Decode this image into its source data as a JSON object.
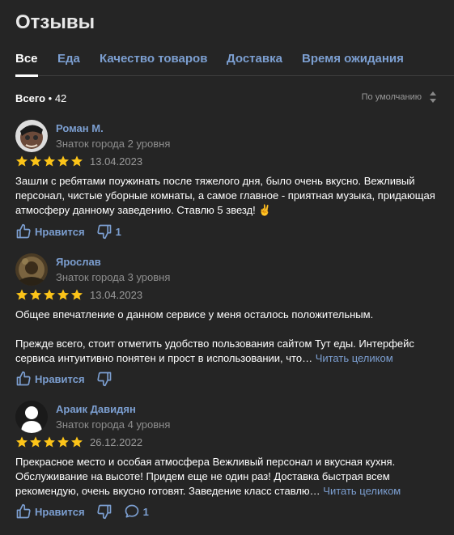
{
  "page": {
    "title": "Отзывы"
  },
  "tabs": [
    {
      "label": "Все",
      "active": true
    },
    {
      "label": "Еда"
    },
    {
      "label": "Качество товаров"
    },
    {
      "label": "Доставка"
    },
    {
      "label": "Время ожидания"
    }
  ],
  "summary": {
    "label": "Всего",
    "separator": " • ",
    "count": "42"
  },
  "sort": {
    "label": "По умолчанию"
  },
  "colors": {
    "accent": "#7c9fd1",
    "star": "#fcc419",
    "background": "#252525"
  },
  "reviews": [
    {
      "author": "Роман М.",
      "level": "Знаток города 2 уровня",
      "stars": 5,
      "date": "13.04.2023",
      "text": "Зашли с ребятами поужинать после тяжелого дня, было очень вкусно. Вежливый персонал, чистые уборные комнаты, а самое главное - приятная музыка, придающая атмосферу данному заведению. Ставлю 5 звезд! ✌",
      "more": "",
      "like_label": "Нравится",
      "dislike_count": "1",
      "comment_count": ""
    },
    {
      "author": "Ярослав",
      "level": "Знаток города 3 уровня",
      "stars": 5,
      "date": "13.04.2023",
      "text": "Общее впечатление о данном сервисе у меня осталось положительным.\n\nПрежде всего, стоит отметить удобство пользования сайтом Тут еды. Интерфейс сервиса интуитивно понятен и прост в использовании, что… ",
      "more": "Читать целиком",
      "like_label": "Нравится",
      "dislike_count": "",
      "comment_count": ""
    },
    {
      "author": "Араик Давидян",
      "level": "Знаток города 4 уровня",
      "stars": 5,
      "date": "26.12.2022",
      "text": "Прекрасное место и особая атмосфера Вежливый персонал и вкусная кухня. Обслуживание на высоте! Придем еще не один раз! Доставка быстрая всем рекомендую, очень вкусно готовят. Заведение класс ставлю… ",
      "more": "Читать целиком",
      "like_label": "Нравится",
      "dislike_count": "",
      "comment_count": "1"
    }
  ]
}
